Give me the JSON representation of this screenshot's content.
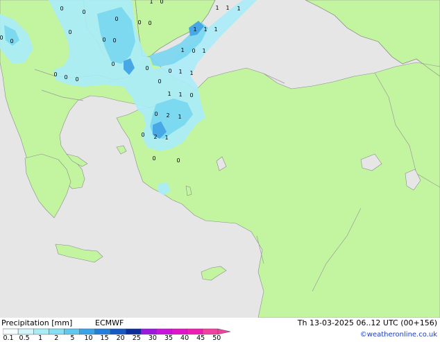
{
  "map": {
    "colors": {
      "sea": "#e6e6e6",
      "land": "#c3f5a0",
      "border": "#9a9a9a",
      "coast": "#8a8a8a",
      "precip_light": "#a8ecf8",
      "precip_medium": "#78d6f0",
      "precip_heavy": "#48a8e6",
      "precip_intense": "#2a6ad0"
    },
    "value_labels": [
      "1",
      "1",
      "1",
      "1",
      "1",
      "1",
      "1",
      "0",
      "1",
      "1",
      "0",
      "0",
      "0",
      "0",
      "0",
      "0",
      "0",
      "0",
      "0",
      "0",
      "0",
      "0",
      "0",
      "0",
      "0",
      "1",
      "0",
      "0",
      "1",
      "0",
      "1",
      "1",
      "0",
      "2",
      "1",
      "0",
      "2",
      "1",
      "0",
      "0",
      "0"
    ]
  },
  "footer": {
    "title": "Precipitation [mm]",
    "model": "ECMWF",
    "valid_time": "Th 13-03-2025 06..12 UTC (00+156)",
    "credit": "©weatheronline.co.uk",
    "legend": {
      "ticks": [
        "0.1",
        "0.5",
        "1",
        "2",
        "5",
        "10",
        "15",
        "20",
        "25",
        "30",
        "35",
        "40",
        "45",
        "50"
      ],
      "colors": [
        "#f4fcfe",
        "#d2f5fc",
        "#a8ecf8",
        "#86e0f4",
        "#5ec8ee",
        "#3aa4e8",
        "#2280dc",
        "#1658c4",
        "#0c2c9c",
        "#9c18dc",
        "#c814dc",
        "#e014c8",
        "#f01cb4",
        "#f040a0"
      ]
    }
  }
}
